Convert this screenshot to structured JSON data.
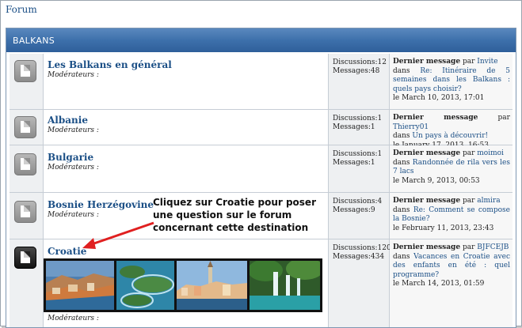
{
  "breadcrumb": "Forum",
  "category": {
    "title": "BALKANS"
  },
  "moderators_label": "Modérateurs :",
  "forums": [
    {
      "name": "Les Balkans en général",
      "discussions": "Discussions:12",
      "messages": "Messages:48",
      "last_label": "Dernier message",
      "by": "par",
      "author": "Invite",
      "in": "dans",
      "topic": "Re: Itinéraire de 5 semaines dans les Balkans : quels pays choisir?",
      "date": "le March 10, 2013, 17:01"
    },
    {
      "name": "Albanie",
      "discussions": "Discussions:1",
      "messages": "Messages:1",
      "last_label": "Dernier message",
      "by": "par",
      "author": "Thierry01",
      "in": "dans",
      "topic": "Un pays à découvrir!",
      "date": "le January 17, 2013, 16:53"
    },
    {
      "name": "Bulgarie",
      "discussions": "Discussions:1",
      "messages": "Messages:1",
      "last_label": "Dernier message",
      "by": "par",
      "author": "moimoi",
      "in": "dans",
      "topic": "Randonnée de rila vers les 7 lacs",
      "date": "le March 9, 2013, 00:53"
    },
    {
      "name": "Bosnie Herzégovine",
      "discussions": "Discussions:4",
      "messages": "Messages:9",
      "last_label": "Dernier message",
      "by": "par",
      "author": "almira",
      "in": "dans",
      "topic": "Re: Comment se compose la Bosnie?",
      "date": "le February 11, 2013, 23:43"
    },
    {
      "name": "Croatie",
      "discussions": "Discussions:120",
      "messages": "Messages:434",
      "last_label": "Dernier message",
      "by": "par",
      "author": "BJFCEJB",
      "in": "dans",
      "topic": "Vacances en Croatie avec des enfants en été : quel programme?",
      "date": "le March 14, 2013, 01:59"
    }
  ],
  "annotation": "Cliquez sur Croatie pour poser une question sur le forum concernant cette destination",
  "colors": {
    "header": "#3d70ab",
    "link": "#1b4f86",
    "arrow": "#e02020"
  }
}
